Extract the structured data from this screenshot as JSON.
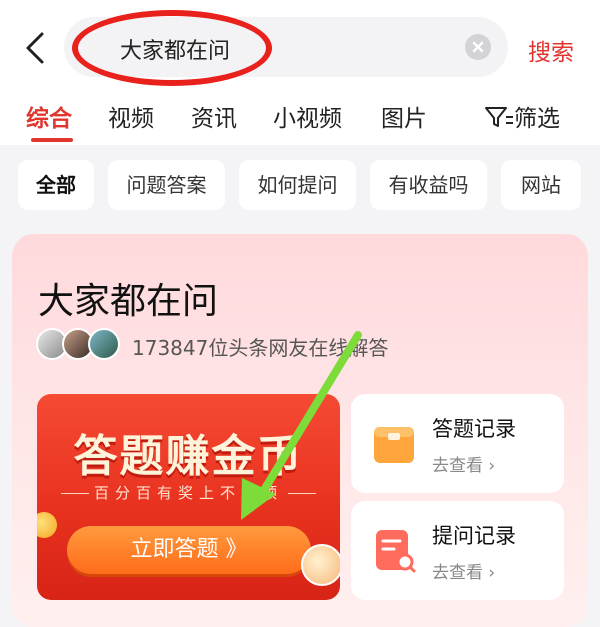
{
  "search": {
    "back_icon": "chevron-left-icon",
    "query": "大家都在问",
    "clear_icon": "clear-circle-icon",
    "submit_label": "搜索"
  },
  "tabs": {
    "items": [
      "综合",
      "视频",
      "资讯",
      "小视频",
      "图片"
    ],
    "active_index": 0,
    "filter_label": "筛选",
    "filter_icon": "filter-icon"
  },
  "chips": {
    "items": [
      "全部",
      "问题答案",
      "如何提问",
      "有收益吗",
      "网站"
    ],
    "active_index": 0
  },
  "card": {
    "title": "大家都在问",
    "subtitle": "173847位头条网友在线解答",
    "banner": {
      "title": "答题赚金币",
      "subtitle": "百分百有奖上不封顶",
      "cta_label": "立即答题 》"
    },
    "side_cards": [
      {
        "title": "答题记录",
        "link": "去查看",
        "icon": "folder-icon"
      },
      {
        "title": "提问记录",
        "link": "去查看",
        "icon": "document-search-icon"
      }
    ]
  },
  "colors": {
    "accent": "#e0362f",
    "annotation_ring": "#e8211d",
    "annotation_arrow": "#7ddb3a",
    "cta_orange": "#ff7a26"
  }
}
